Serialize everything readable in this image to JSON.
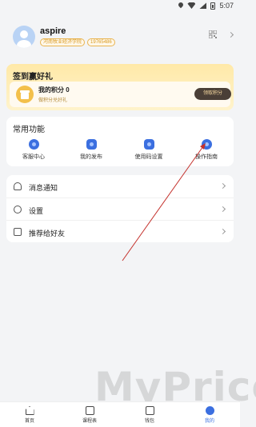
{
  "status_bar": {
    "time": "5:07"
  },
  "profile": {
    "username": "aspire",
    "tags": [
      "河南牧业经济学院",
      "19765486"
    ]
  },
  "signin": {
    "title": "签到赢好礼",
    "points_title": "我的积分 0",
    "points_subtitle": "做积分兑好礼",
    "claim_button": "领取积分"
  },
  "functions": {
    "title": "常用功能",
    "items": [
      {
        "label": "客服中心",
        "icon": "headset-icon"
      },
      {
        "label": "我的发布",
        "icon": "publish-icon"
      },
      {
        "label": "使用码设置",
        "icon": "code-settings-icon"
      },
      {
        "label": "操作指南",
        "icon": "guide-icon"
      }
    ]
  },
  "list": {
    "items": [
      {
        "label": "消息通知",
        "icon": "bell-icon"
      },
      {
        "label": "设置",
        "icon": "gear-icon"
      },
      {
        "label": "推荐给好友",
        "icon": "share-icon"
      }
    ]
  },
  "watermark": {
    "text": "MyPrice",
    "url": "myprice.com.cn"
  },
  "bottom_nav": {
    "items": [
      {
        "label": "首页",
        "icon": "home-icon",
        "active": false
      },
      {
        "label": "课程表",
        "icon": "calendar-icon",
        "active": false
      },
      {
        "label": "钱包",
        "icon": "wallet-icon",
        "active": false
      },
      {
        "label": "我的",
        "icon": "profile-icon",
        "active": true
      }
    ]
  },
  "colors": {
    "accent": "#3b6fe0",
    "gold": "#f3c04b",
    "annotation_red": "#c4302b"
  }
}
